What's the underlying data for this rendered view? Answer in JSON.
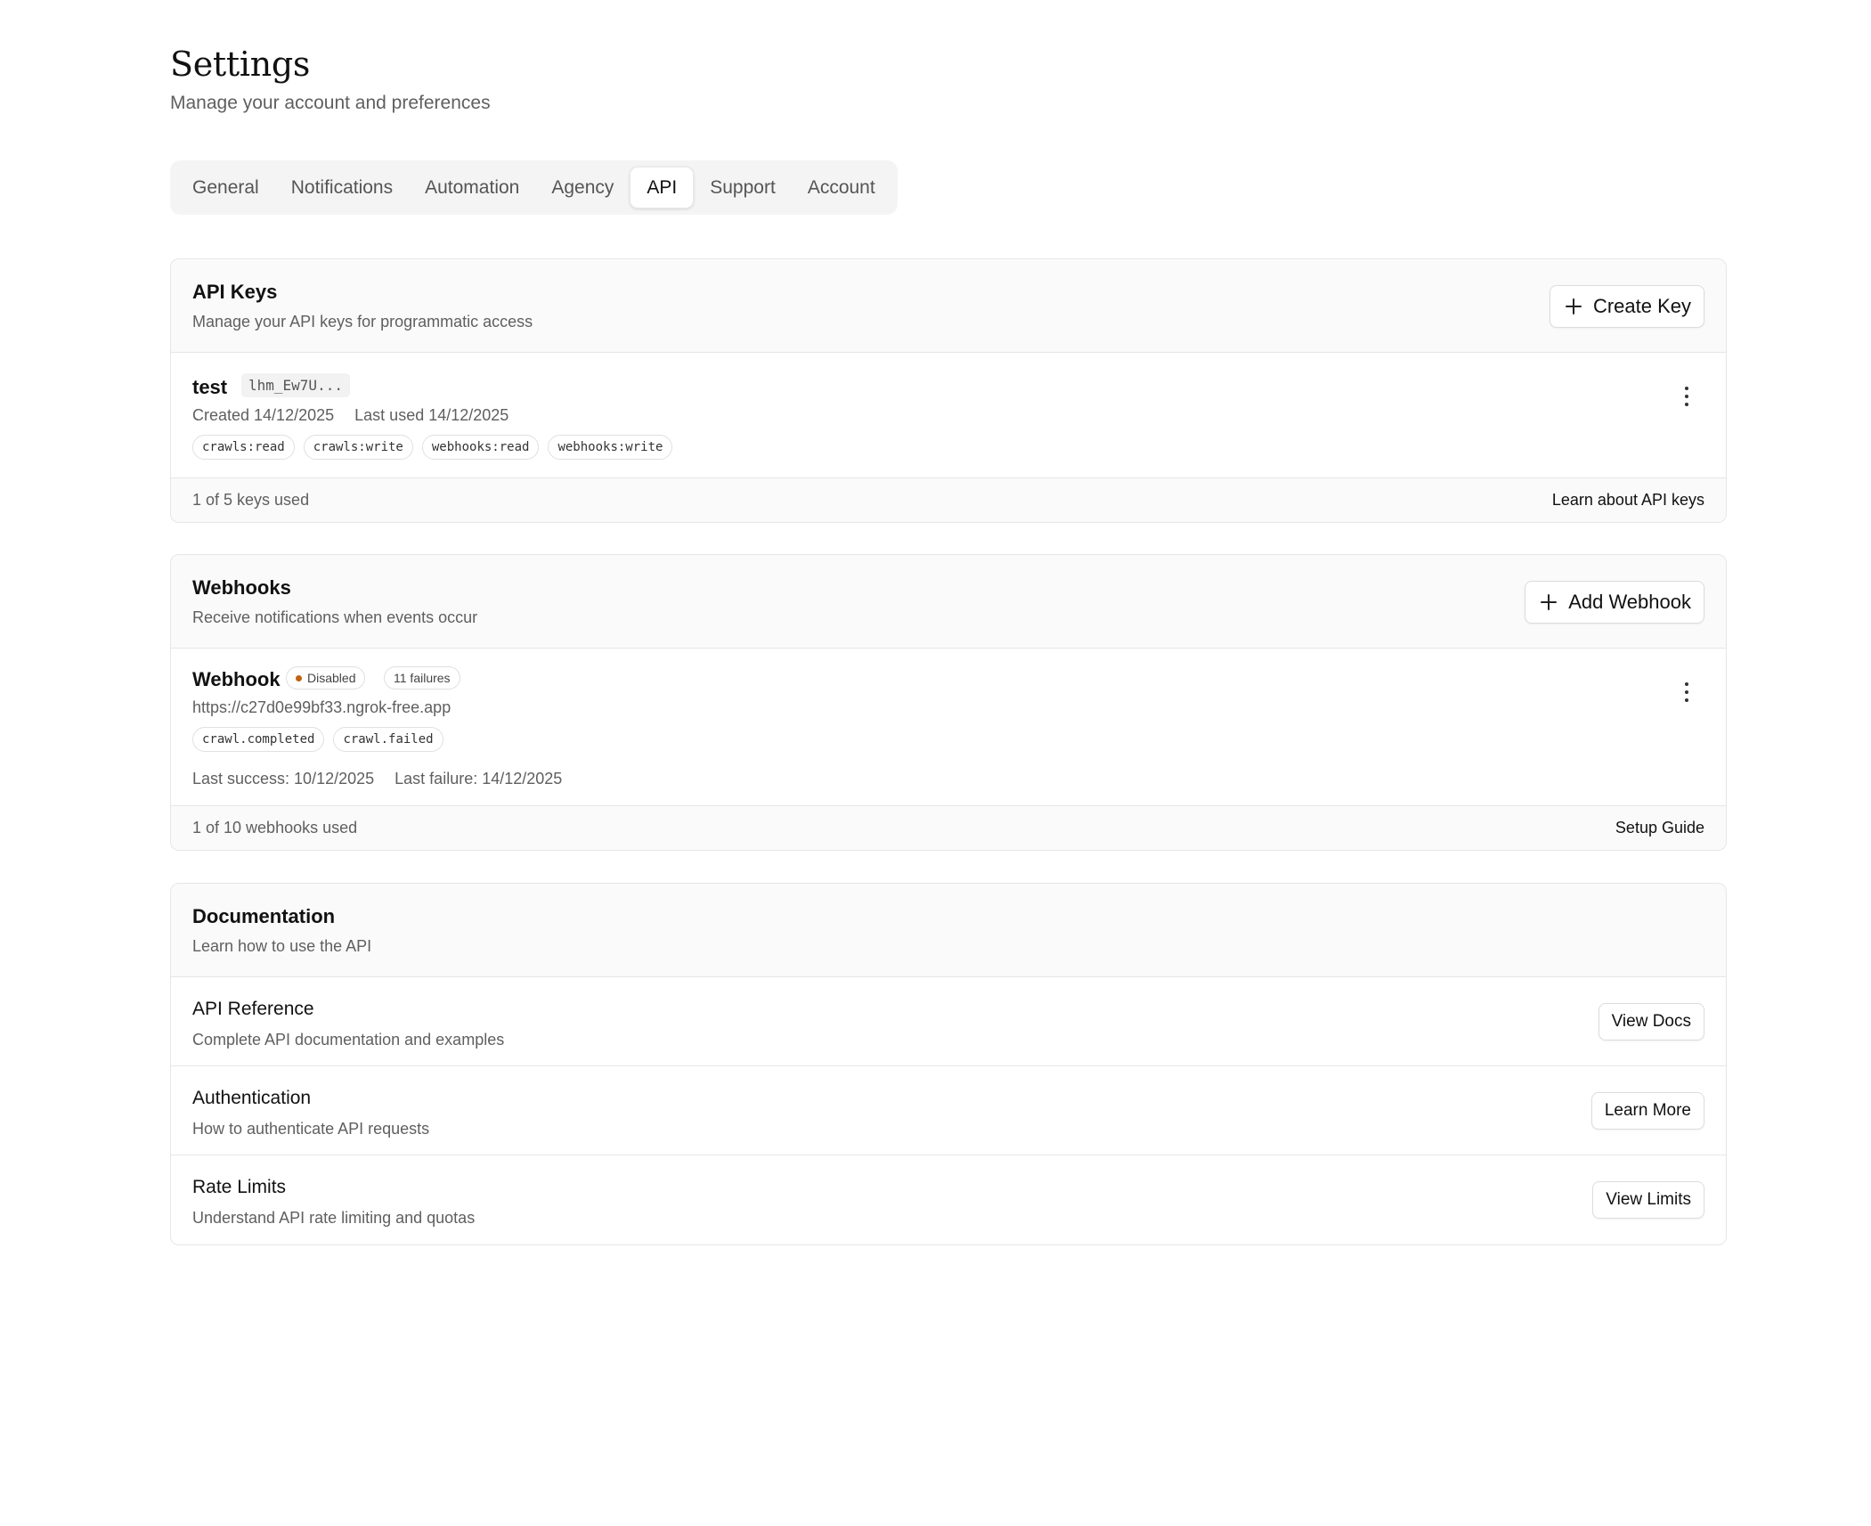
{
  "header": {
    "title": "Settings",
    "subtitle": "Manage your account and preferences"
  },
  "tabs": [
    {
      "label": "General",
      "active": false
    },
    {
      "label": "Notifications",
      "active": false
    },
    {
      "label": "Automation",
      "active": false
    },
    {
      "label": "Agency",
      "active": false
    },
    {
      "label": "API",
      "active": true
    },
    {
      "label": "Support",
      "active": false
    },
    {
      "label": "Account",
      "active": false
    }
  ],
  "api_keys": {
    "title": "API Keys",
    "description": "Manage your API keys for programmatic access",
    "create_label": "Create Key",
    "create_icon": "plus-icon",
    "keys": [
      {
        "name": "test",
        "prefix": "lhm_Ew7U...",
        "created": "Created 14/12/2025",
        "last_used": "Last used 14/12/2025",
        "scopes": [
          "crawls:read",
          "crawls:write",
          "webhooks:read",
          "webhooks:write"
        ],
        "menu_icon": "more-vertical-icon"
      }
    ],
    "usage": "1 of 5 keys used",
    "learn_link": "Learn about API keys"
  },
  "webhooks": {
    "title": "Webhooks",
    "description": "Receive notifications when events occur",
    "add_label": "Add Webhook",
    "add_icon": "plus-icon",
    "items": [
      {
        "name": "Webhook",
        "status": "Disabled",
        "status_color": "#c2620e",
        "failures": "11 failures",
        "url": "https://c27d0e99bf33.ngrok-free.app",
        "events": [
          "crawl.completed",
          "crawl.failed"
        ],
        "last_success": "Last success: 10/12/2025",
        "last_failure": "Last failure: 14/12/2025",
        "menu_icon": "more-vertical-icon"
      }
    ],
    "usage": "1 of 10 webhooks used",
    "guide_link": "Setup Guide"
  },
  "documentation": {
    "title": "Documentation",
    "description": "Learn how to use the API",
    "items": [
      {
        "title": "API Reference",
        "description": "Complete API documentation and examples",
        "button": "View Docs"
      },
      {
        "title": "Authentication",
        "description": "How to authenticate API requests",
        "button": "Learn More"
      },
      {
        "title": "Rate Limits",
        "description": "Understand API rate limiting and quotas",
        "button": "View Limits"
      }
    ]
  }
}
